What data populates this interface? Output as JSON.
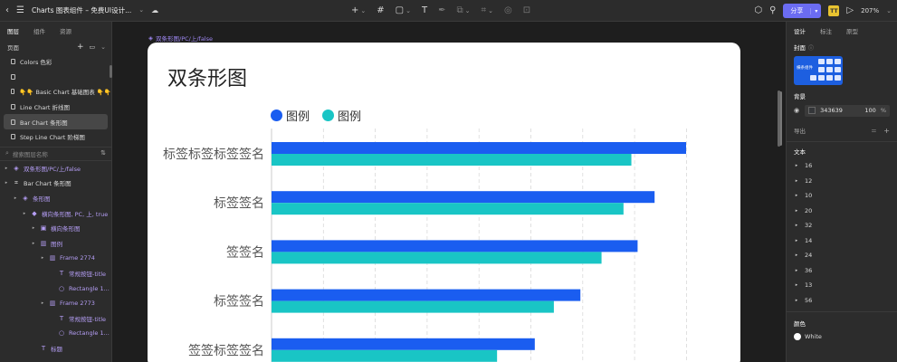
{
  "topbar": {
    "title": "Charts 图表组件 – 免费UI设计...",
    "share_label": "分享",
    "avatar_label": "TT",
    "zoom": "207%"
  },
  "left_panel": {
    "tabs": [
      "图层",
      "组件",
      "资源"
    ],
    "pages_label": "页面",
    "pages": [
      "Colors 色彩",
      "",
      "👇👇 Basic Chart 基础图表 👇👇",
      "Line Chart 折线图",
      "Bar Chart 条形图",
      "Step Line Chart 阶梯图"
    ],
    "search_placeholder": "搜索图层名称",
    "layers": [
      {
        "label": "双条形图/PC/上/false",
        "indent": 0
      },
      {
        "label": "Bar Chart 条形图",
        "indent": 0
      },
      {
        "label": "条形图",
        "indent": 1
      },
      {
        "label": "横向条形图, PC, 上, true",
        "indent": 2
      },
      {
        "label": "横向条形图",
        "indent": 3
      },
      {
        "label": "图例",
        "indent": 3
      },
      {
        "label": "Frame 2774",
        "indent": 4
      },
      {
        "label": "常规按钮-title",
        "indent": 5
      },
      {
        "label": "Rectangle 1...",
        "indent": 5
      },
      {
        "label": "Frame 2773",
        "indent": 4
      },
      {
        "label": "常规按钮-title",
        "indent": 5
      },
      {
        "label": "Rectangle 1...",
        "indent": 5
      },
      {
        "label": "标题",
        "indent": 3
      }
    ]
  },
  "canvas": {
    "frame_label": "双条形图/PC/上/false"
  },
  "chart_data": {
    "type": "bar",
    "orientation": "horizontal",
    "title": "双条形图",
    "categories": [
      "标签标签标签签名",
      "标签签名",
      "签签名",
      "标签签名",
      "签签标签签名"
    ],
    "series": [
      {
        "name": "图例",
        "color": "#1a5df0",
        "values": [
          100,
          92.4,
          88.3,
          74.5,
          63.5
        ]
      },
      {
        "name": "图例",
        "color": "#19c5c5",
        "values": [
          86.8,
          84.9,
          79.6,
          68.1,
          54.4
        ]
      }
    ],
    "xlim": [
      0,
      105
    ],
    "grid": true,
    "legend": "top-left"
  },
  "right_panel": {
    "tabs": [
      "设计",
      "标注",
      "原型"
    ],
    "cover_label": "封面",
    "thumb_text": "横条组件",
    "background_label": "背景",
    "bg_hex": "343639",
    "bg_opacity": "100",
    "bg_unit": "%",
    "export_label": "导出",
    "text_label": "文本",
    "text_sizes": [
      "16",
      "12",
      "10",
      "20",
      "32",
      "14",
      "24",
      "36",
      "13",
      "56"
    ],
    "color_label": "颜色",
    "color_white": "White"
  }
}
